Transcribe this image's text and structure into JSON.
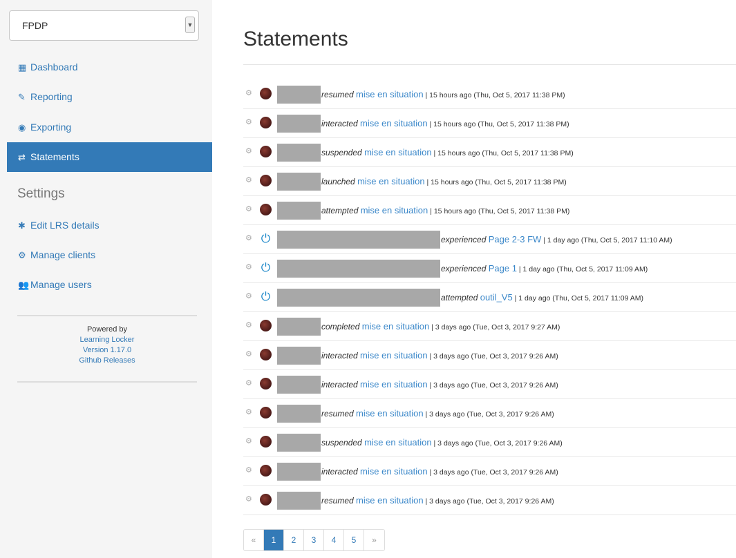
{
  "sidebar": {
    "lrs_select": {
      "value": "FPDP",
      "icon": "chevron-down-icon"
    },
    "nav": [
      {
        "label": "Dashboard",
        "icon": "bar-chart-icon",
        "glyph": "▦"
      },
      {
        "label": "Reporting",
        "icon": "pencil-icon",
        "glyph": "✎"
      },
      {
        "label": "Exporting",
        "icon": "circle-dot-icon",
        "glyph": "◉"
      },
      {
        "label": "Statements",
        "icon": "exchange-icon",
        "glyph": "⇄",
        "active": true
      }
    ],
    "settings_heading": "Settings",
    "settings": [
      {
        "label": "Edit LRS details",
        "icon": "gear-icon",
        "glyph": "✱"
      },
      {
        "label": "Manage clients",
        "icon": "gears-icon",
        "glyph": "⚙"
      },
      {
        "label": "Manage users",
        "icon": "users-icon",
        "glyph": "👥"
      }
    ],
    "footer": {
      "powered_by": "Powered by",
      "app_name": "Learning Locker",
      "version": "Version 1.17.0",
      "releases": "Github Releases"
    }
  },
  "main": {
    "title": "Statements",
    "statements": [
      {
        "verb": "resumed",
        "object": "mise en situation",
        "meta": " | 15 hours ago (Thu, Oct 5, 2017 11:38 PM)",
        "avatar": "photo"
      },
      {
        "verb": "interacted",
        "object": "mise en situation",
        "meta": " | 15 hours ago (Thu, Oct 5, 2017 11:38 PM)",
        "avatar": "photo"
      },
      {
        "verb": "suspended",
        "object": "mise en situation",
        "meta": " | 15 hours ago (Thu, Oct 5, 2017 11:38 PM)",
        "avatar": "photo"
      },
      {
        "verb": "launched",
        "object": "mise en situation",
        "meta": " | 15 hours ago (Thu, Oct 5, 2017 11:38 PM)",
        "avatar": "photo"
      },
      {
        "verb": "attempted",
        "object": "mise en situation",
        "meta": " | 15 hours ago (Thu, Oct 5, 2017 11:38 PM)",
        "avatar": "photo"
      },
      {
        "verb": "experienced",
        "object": "Page 2-3 FW",
        "meta": " | 1 day ago (Thu, Oct 5, 2017 11:10 AM)",
        "avatar": "power"
      },
      {
        "verb": "experienced",
        "object": "Page 1",
        "meta": " | 1 day ago (Thu, Oct 5, 2017 11:09 AM)",
        "avatar": "power"
      },
      {
        "verb": "attempted",
        "object": "outil_V5",
        "meta": " | 1 day ago (Thu, Oct 5, 2017 11:09 AM)",
        "avatar": "power"
      },
      {
        "verb": "completed",
        "object": "mise en situation",
        "meta": " | 3 days ago (Tue, Oct 3, 2017 9:27 AM)",
        "avatar": "photo"
      },
      {
        "verb": "interacted",
        "object": "mise en situation",
        "meta": " | 3 days ago (Tue, Oct 3, 2017 9:26 AM)",
        "avatar": "photo"
      },
      {
        "verb": "interacted",
        "object": "mise en situation",
        "meta": " | 3 days ago (Tue, Oct 3, 2017 9:26 AM)",
        "avatar": "photo"
      },
      {
        "verb": "resumed",
        "object": "mise en situation",
        "meta": " | 3 days ago (Tue, Oct 3, 2017 9:26 AM)",
        "avatar": "photo"
      },
      {
        "verb": "suspended",
        "object": "mise en situation",
        "meta": " | 3 days ago (Tue, Oct 3, 2017 9:26 AM)",
        "avatar": "photo"
      },
      {
        "verb": "interacted",
        "object": "mise en situation",
        "meta": " | 3 days ago (Tue, Oct 3, 2017 9:26 AM)",
        "avatar": "photo"
      },
      {
        "verb": "resumed",
        "object": "mise en situation",
        "meta": " | 3 days ago (Tue, Oct 3, 2017 9:26 AM)",
        "avatar": "photo"
      }
    ],
    "pagination": {
      "prev": "«",
      "pages": [
        "1",
        "2",
        "3",
        "4",
        "5"
      ],
      "active_page": "1",
      "next": "»"
    }
  },
  "colors": {
    "accent": "#337ab7",
    "link": "#3a87c9",
    "sidebar_bg": "#f5f5f5",
    "redaction": "#a8a8a8"
  }
}
